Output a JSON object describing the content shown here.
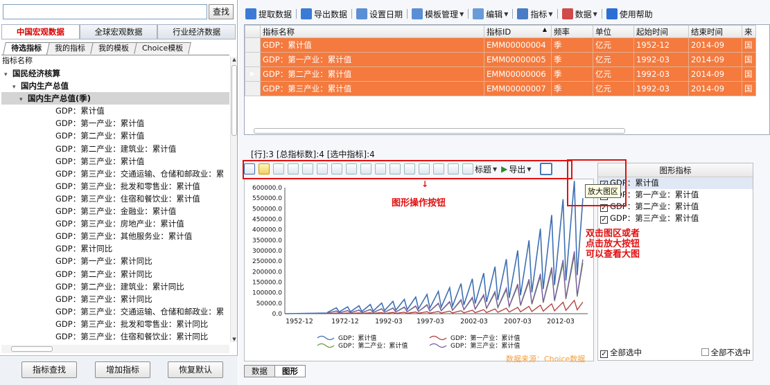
{
  "search": {
    "placeholder": "",
    "button": "查找"
  },
  "cat_tabs": [
    "中国宏观数据",
    "全球宏观数据",
    "行业经济数据"
  ],
  "sub_tabs": [
    "待选指标",
    "我的指标",
    "我的模板",
    "Choice模板"
  ],
  "tree": {
    "header": "指标名称",
    "nodes": [
      {
        "t": "国民经济核算",
        "lvl": 0,
        "b": true,
        "arrow": true
      },
      {
        "t": "国内生产总值",
        "lvl": 1,
        "b": true,
        "arrow": true
      },
      {
        "t": "国内生产总值(季)",
        "lvl": 2,
        "b": true,
        "arrow": true,
        "sel": true
      },
      {
        "t": "GDP：累计值",
        "lvl": 3
      },
      {
        "t": "GDP：第一产业：累计值",
        "lvl": 3
      },
      {
        "t": "GDP：第二产业：累计值",
        "lvl": 3
      },
      {
        "t": "GDP：第二产业：建筑业：累计值",
        "lvl": 3
      },
      {
        "t": "GDP：第三产业：累计值",
        "lvl": 3
      },
      {
        "t": "GDP：第三产业：交通运输、仓储和邮政业：累",
        "lvl": 3
      },
      {
        "t": "GDP：第三产业：批发和零售业：累计值",
        "lvl": 3
      },
      {
        "t": "GDP：第三产业：住宿和餐饮业：累计值",
        "lvl": 3
      },
      {
        "t": "GDP：第三产业：金融业：累计值",
        "lvl": 3
      },
      {
        "t": "GDP：第三产业：房地产业：累计值",
        "lvl": 3
      },
      {
        "t": "GDP：第三产业：其他服务业：累计值",
        "lvl": 3
      },
      {
        "t": "GDP：累计同比",
        "lvl": 3
      },
      {
        "t": "GDP：第一产业：累计同比",
        "lvl": 3
      },
      {
        "t": "GDP：第二产业：累计同比",
        "lvl": 3
      },
      {
        "t": "GDP：第二产业：建筑业：累计同比",
        "lvl": 3
      },
      {
        "t": "GDP：第三产业：累计同比",
        "lvl": 3
      },
      {
        "t": "GDP：第三产业：交通运输、仓储和邮政业：累",
        "lvl": 3
      },
      {
        "t": "GDP：第三产业：批发和零售业：累计同比",
        "lvl": 3
      },
      {
        "t": "GDP：第三产业：住宿和餐饮业：累计同比",
        "lvl": 3
      }
    ]
  },
  "left_buttons": [
    "指标查找",
    "增加指标",
    "恢复默认"
  ],
  "toolbar": [
    {
      "label": "提取数据",
      "icon": "extract-icon",
      "color": "#3b7bd6"
    },
    {
      "label": "导出数据",
      "icon": "export-icon",
      "color": "#3b7bd6"
    },
    {
      "label": "设置日期",
      "icon": "calendar-icon",
      "color": "#5a8fd6"
    },
    {
      "label": "模板管理",
      "icon": "template-icon",
      "color": "#5a8fd6",
      "caret": true
    },
    {
      "label": "编辑",
      "icon": "edit-icon",
      "color": "#6b9ad8",
      "caret": true
    },
    {
      "label": "指标",
      "icon": "fx-icon",
      "color": "#4a7bc6",
      "caret": true
    },
    {
      "label": "数据",
      "icon": "data-icon",
      "color": "#d04a4a",
      "caret": true
    },
    {
      "label": "使用帮助",
      "icon": "help-icon",
      "color": "#2b6fd6"
    }
  ],
  "grid": {
    "columns": [
      "指标名称",
      "指标ID",
      "频率",
      "单位",
      "起始时间",
      "结束时间",
      "来"
    ],
    "rows": [
      [
        "GDP：累计值",
        "EMM00000004",
        "季",
        "亿元",
        "1952-12",
        "2014-09",
        "国"
      ],
      [
        "GDP：第一产业：累计值",
        "EMM00000005",
        "季",
        "亿元",
        "1992-03",
        "2014-09",
        "国"
      ],
      [
        "GDP：第二产业：累计值",
        "EMM00000006",
        "季",
        "亿元",
        "1992-03",
        "2014-09",
        "国"
      ],
      [
        "GDP：第三产业：累计值",
        "EMM00000007",
        "季",
        "亿元",
        "1992-03",
        "2014-09",
        "国"
      ]
    ]
  },
  "status": "[行]:3 [总指标数]:4 [选中指标]:4",
  "chart_tb": {
    "title_label": "标题",
    "export_label": "导出"
  },
  "chart_data": {
    "type": "line",
    "ylim": [
      0,
      600000
    ],
    "yticks": [
      "600000.0",
      "550000.0",
      "500000.0",
      "450000.0",
      "400000.0",
      "350000.0",
      "300000.0",
      "250000.0",
      "200000.0",
      "150000.0",
      "100000.0",
      "50000.0",
      "0.0"
    ],
    "xticks": [
      "1952-12",
      "1972-12",
      "1992-03",
      "1997-03",
      "2002-03",
      "2007-03",
      "2012-03"
    ],
    "series": [
      {
        "name": "GDP：累计值",
        "color": "#3d6fb0"
      },
      {
        "name": "GDP：第一产业：累计值",
        "color": "#b03a3a"
      },
      {
        "name": "GDP：第二产业：累计值",
        "color": "#6a9a40"
      },
      {
        "name": "GDP：第三产业：累计值",
        "color": "#7a5aa8"
      }
    ]
  },
  "legend_panel": {
    "title": "图形指标",
    "items": [
      "GDP：累计值",
      "GDP：第一产业：累计值",
      "GDP：第二产业：累计值",
      "GDP：第三产业：累计值"
    ],
    "select_all": "全部选中",
    "deselect_all": "全部不选中"
  },
  "data_source": "数据来源：Choice数据",
  "bottom_tabs": [
    "数据",
    "图形"
  ],
  "annotations": {
    "chart_buttons": "图形操作按钮",
    "zoom_tooltip": "放大图区",
    "zoom_hint": [
      "双击图区或者",
      "点击放大按钮",
      "可以查看大图"
    ]
  }
}
